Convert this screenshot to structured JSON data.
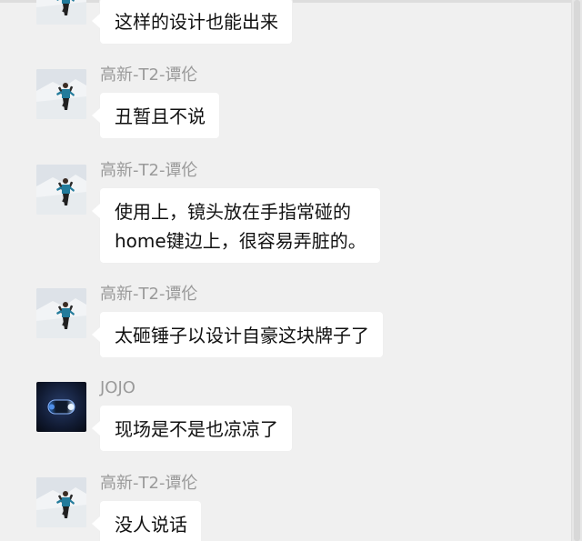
{
  "messages": [
    {
      "sender": "",
      "avatar": "skier-photo",
      "lines": [
        "这样的设计也能出来"
      ]
    },
    {
      "sender": "高新-T2-谭伦",
      "avatar": "skier-photo",
      "lines": [
        "丑暂且不说"
      ]
    },
    {
      "sender": "高新-T2-谭伦",
      "avatar": "skier-photo",
      "lines": [
        "使用上，镜头放在手指常碰的",
        "home键边上，很容易弄脏的。"
      ]
    },
    {
      "sender": "高新-T2-谭伦",
      "avatar": "skier-photo",
      "lines": [
        "太砸锤子以设计自豪这块牌子了"
      ]
    },
    {
      "sender": "JOJO",
      "avatar": "dark-pill-logo",
      "lines": [
        "现场是不是也凉凉了"
      ]
    },
    {
      "sender": "高新-T2-谭伦",
      "avatar": "skier-photo",
      "lines": [
        "没人说话"
      ]
    }
  ]
}
